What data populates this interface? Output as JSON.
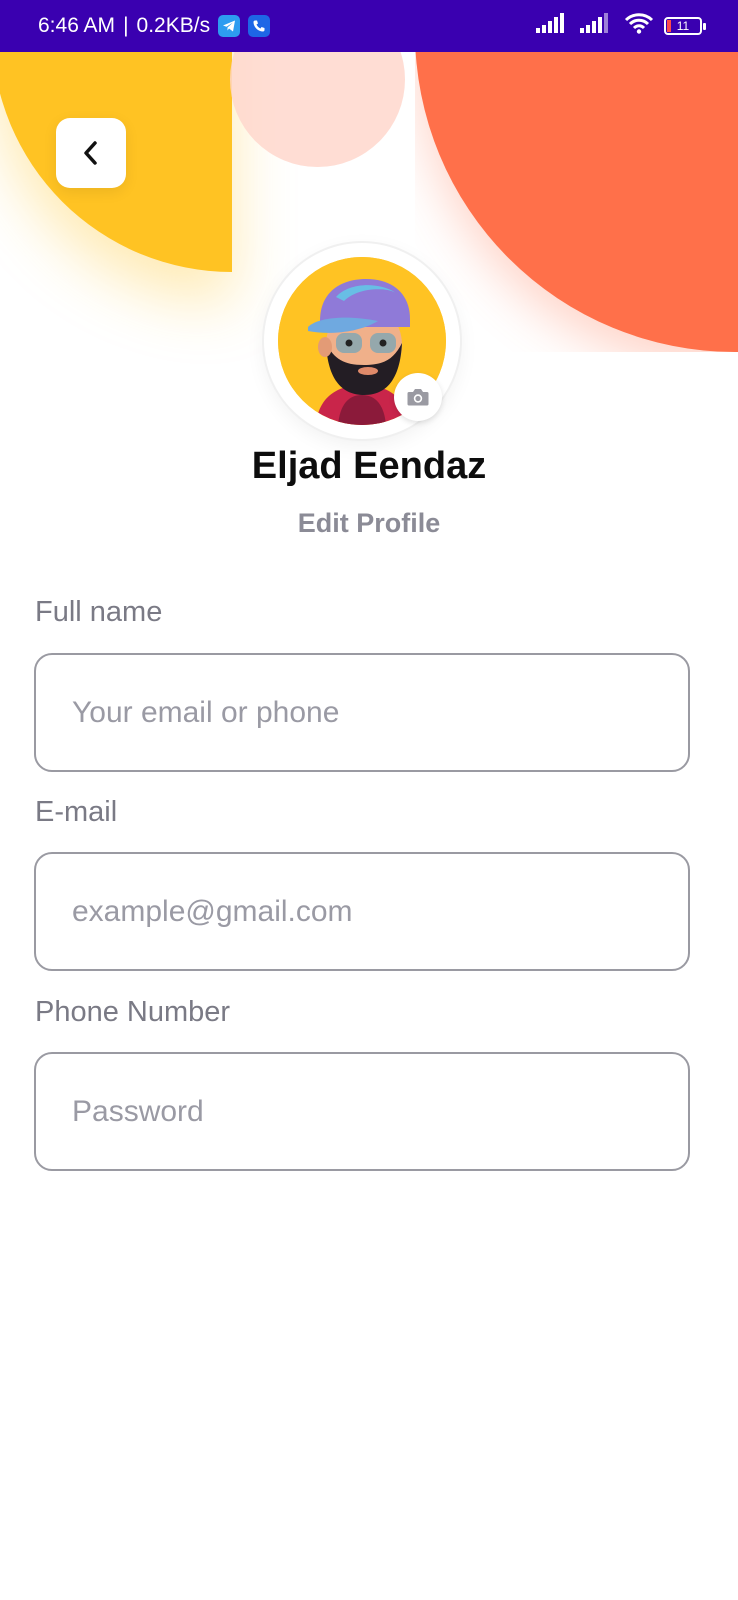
{
  "status_bar": {
    "time": "6:46 AM",
    "separator": "|",
    "speed": "0.2KB/s",
    "battery_level": "11",
    "icons": [
      "telegram-icon",
      "phone-icon",
      "signal-icon",
      "signal-icon",
      "wifi-icon",
      "battery-icon"
    ]
  },
  "colors": {
    "status_bar": "#3a00b0",
    "yellow": "#ffc323",
    "orange": "#ff704a",
    "pink": "#ffd7cc"
  },
  "header": {
    "back_icon": "chevron-left-icon"
  },
  "profile": {
    "name": "Eljad Eendaz",
    "edit_label": "Edit Profile",
    "camera_icon": "camera-icon"
  },
  "form": {
    "full_name": {
      "label": "Full name",
      "placeholder": "Your email or phone"
    },
    "email": {
      "label": "E-mail",
      "placeholder": "example@gmail.com"
    },
    "phone": {
      "label": "Phone Number",
      "placeholder": "Password"
    }
  }
}
